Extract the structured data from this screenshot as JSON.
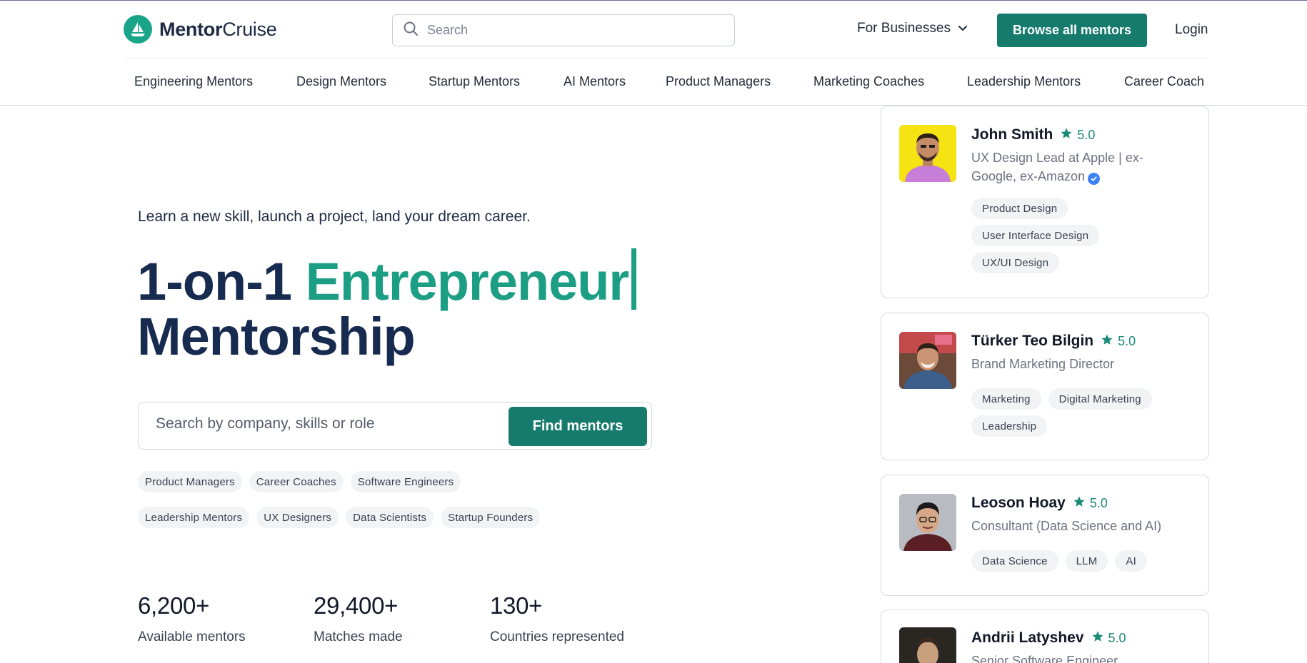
{
  "header": {
    "logo_bold": "Mentor",
    "logo_light": "Cruise",
    "search_placeholder": "Search",
    "for_businesses": "For Businesses",
    "browse_button": "Browse all mentors",
    "login": "Login"
  },
  "nav": {
    "items": [
      "Engineering Mentors",
      "Design Mentors",
      "Startup Mentors",
      "AI Mentors",
      "Product Managers",
      "Marketing Coaches",
      "Leadership Mentors",
      "Career Coach"
    ]
  },
  "hero": {
    "tagline": "Learn a new skill, launch a project, land your dream career.",
    "headline_prefix": "1-on-1",
    "headline_accent": "Entrepreneur",
    "headline_suffix": "Mentorship",
    "search_placeholder": "Search by company, skills or role",
    "find_button": "Find mentors",
    "chips": [
      "Product Managers",
      "Career Coaches",
      "Software Engineers",
      "Leadership Mentors",
      "UX Designers",
      "Data Scientists",
      "Startup Founders"
    ]
  },
  "stats": [
    {
      "value": "6,200+",
      "label": "Available mentors"
    },
    {
      "value": "29,400+",
      "label": "Matches made"
    },
    {
      "value": "130+",
      "label": "Countries represented"
    }
  ],
  "mentors": [
    {
      "name": "John Smith",
      "rating": "5.0",
      "title": "UX Design Lead at Apple | ex-Google, ex-Amazon",
      "verified": true,
      "tags": [
        "Product Design",
        "User Interface Design",
        "UX/UI Design"
      ]
    },
    {
      "name": "Türker Teo Bilgin",
      "rating": "5.0",
      "title": "Brand Marketing Director",
      "tags": [
        "Marketing",
        "Digital Marketing",
        "Leadership"
      ]
    },
    {
      "name": "Leoson Hoay",
      "rating": "5.0",
      "title": "Consultant (Data Science and AI)",
      "tags": [
        "Data Science",
        "LLM",
        "AI"
      ]
    },
    {
      "name": "Andrii Latyshev",
      "rating": "5.0",
      "title": "Senior Software Engineer"
    }
  ],
  "colors": {
    "brand_teal": "#167b6c",
    "accent_teal": "#1c9e84",
    "headline_navy": "#172a4f"
  },
  "icons": {
    "logo": "sailboat-icon",
    "search": "search-icon",
    "dropdown": "chevron-down-icon",
    "rating": "star-icon",
    "verified": "verified-check-icon"
  }
}
